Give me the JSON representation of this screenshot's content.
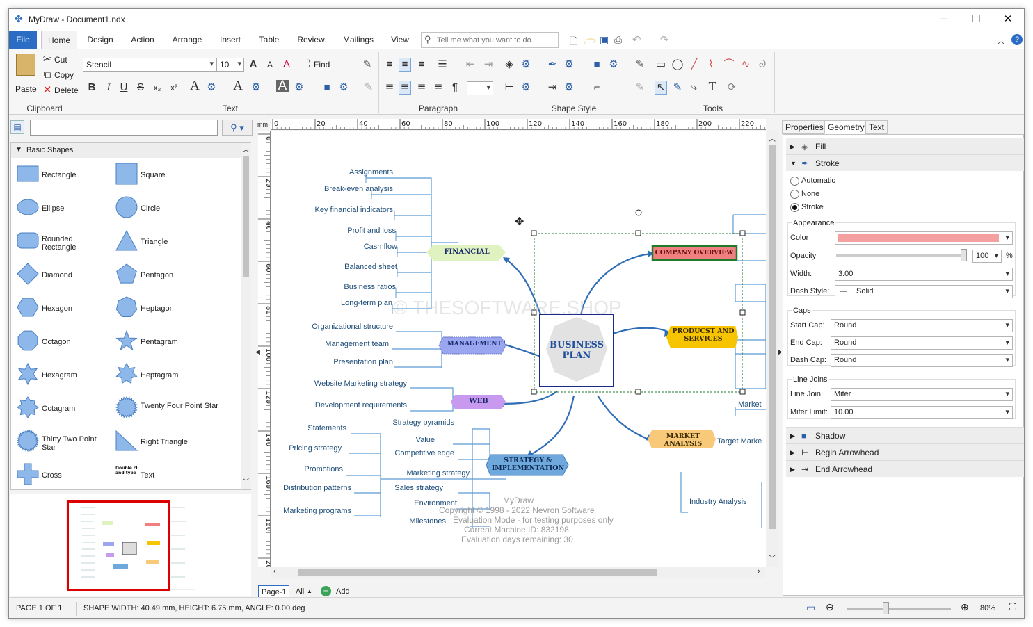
{
  "app": {
    "title": "MyDraw - Document1.ndx",
    "minimize": "─",
    "maximize": "☐",
    "close": "✕"
  },
  "menu": {
    "file": "File",
    "tabs": [
      "Home",
      "Design",
      "Action",
      "Arrange",
      "Insert",
      "Table",
      "Review",
      "Mailings",
      "View"
    ],
    "search_placeholder": "Tell me what you want to do"
  },
  "ribbon": {
    "clipboard": {
      "label": "Clipboard",
      "paste": "Paste",
      "cut": "Cut",
      "copy": "Copy",
      "delete": "Delete"
    },
    "text": {
      "label": "Text",
      "font": "Stencil",
      "size": "10",
      "find": "Find"
    },
    "paragraph": {
      "label": "Paragraph"
    },
    "shape_style": {
      "label": "Shape Style"
    },
    "tools": {
      "label": "Tools"
    }
  },
  "left_panel": {
    "search_value": "",
    "category": "Basic Shapes",
    "shapes": [
      "Rectangle",
      "Square",
      "Ellipse",
      "Circle",
      "Rounded Rectangle",
      "Triangle",
      "Diamond",
      "Pentagon",
      "Hexagon",
      "Heptagon",
      "Octagon",
      "Pentagram",
      "Hexagram",
      "Heptagram",
      "Octagram",
      "Twenty Four Point Star",
      "Thirty Two Point Star",
      "Right Triangle",
      "Cross",
      "Text"
    ],
    "text_shape_hint": "Double click and type your text"
  },
  "canvas": {
    "ruler_unit": "mm",
    "h_ruler": [
      "0",
      "20",
      "40",
      "60",
      "80",
      "100",
      "120",
      "140",
      "160",
      "180",
      "200",
      "220"
    ],
    "v_ruler": [
      "0",
      "20",
      "40",
      "60",
      "80",
      "100",
      "120",
      "140",
      "160",
      "180",
      "200"
    ],
    "center": "BUSINESS PLAN",
    "branches": {
      "financial": "FINANCIAL",
      "management": "MANAGEMENT",
      "web": "WEB",
      "strategy": "STRATEGY & IMPLEMENTATION",
      "company": "COMPANY OVERVIEW",
      "products": "PRODUCST AND SERVICES",
      "market": "MARKET ANALYSIS"
    },
    "financial_items": [
      "Assignments",
      "Break-even analysis",
      "Key financial indicators",
      "Profit and loss",
      "Cash flow",
      "Balanced sheet",
      "Business ratios",
      "Long-term plan"
    ],
    "management_items": [
      "Organizational structure",
      "Management team",
      "Presentation plan"
    ],
    "web_items": [
      "Website Marketing strategy",
      "Development requirements"
    ],
    "marketing_items": [
      "Statements",
      "Pricing strategy",
      "Promotions",
      "Distribution patterns",
      "Marketing programs"
    ],
    "strategy_items": [
      "Strategy pyramids",
      "Value",
      "Competitive edge",
      "Marketing strategy",
      "Sales strategy",
      "Environment",
      "Milestones"
    ],
    "market_items": [
      "Market",
      "Target Marke",
      "Industry Analysis"
    ],
    "watermark": "© THESOFTWARE.SHOP",
    "eval": [
      "MyDraw",
      "Copyright © 1998 - 2022 Nevron Software",
      "Evaluation Mode - for testing purposes only",
      "Current Machine ID: 832198",
      "Evaluation days remaining: 30"
    ],
    "page_tab": "Page-1",
    "all": "All",
    "add": "Add"
  },
  "right_panel": {
    "tabs": [
      "Properties",
      "Geometry",
      "Text"
    ],
    "fill": "Fill",
    "stroke": "Stroke",
    "radios": [
      "Automatic",
      "None",
      "Stroke"
    ],
    "appearance": "Appearance",
    "color_label": "Color",
    "color_value": "#f4a0a0",
    "opacity_label": "Opacity",
    "opacity": "100",
    "pct": "%",
    "width_label": "Width:",
    "width": "3.00",
    "dash_label": "Dash Style:",
    "dash": "Solid",
    "caps": "Caps",
    "start_cap_label": "Start Cap:",
    "start_cap": "Round",
    "end_cap_label": "End Cap:",
    "end_cap": "Round",
    "dash_cap_label": "Dash Cap:",
    "dash_cap": "Round",
    "line_joins": "Line Joins",
    "line_join_label": "Line Join:",
    "line_join": "Miter",
    "miter_label": "Miter Limit:",
    "miter": "10.00",
    "shadow": "Shadow",
    "begin_arrow": "Begin Arrowhead",
    "end_arrow": "End Arrowhead"
  },
  "status": {
    "page": "PAGE 1 OF 1",
    "shape": "SHAPE WIDTH: 40.49 mm, HEIGHT: 6.75 mm, ANGLE: 0.00 deg",
    "zoom": "80%"
  }
}
